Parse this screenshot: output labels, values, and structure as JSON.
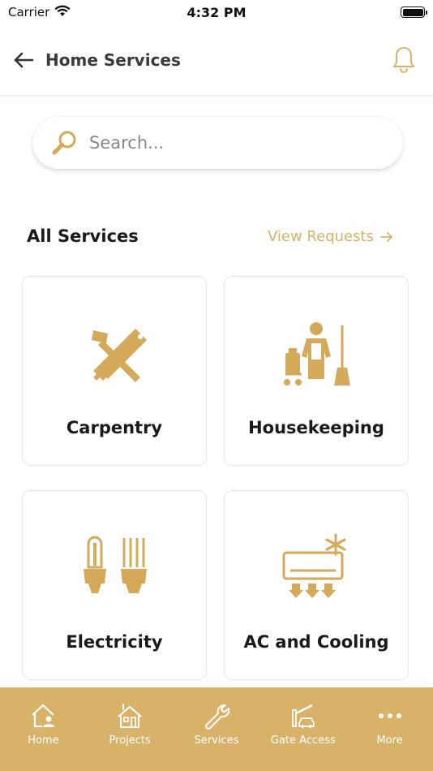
{
  "status": {
    "carrier": "Carrier",
    "time": "4:32 PM"
  },
  "header": {
    "title": "Home Services"
  },
  "search": {
    "placeholder": "Search..."
  },
  "section": {
    "title": "All Services",
    "view_requests": "View Requests"
  },
  "services": [
    {
      "label": "Carpentry",
      "icon": "carpentry-icon"
    },
    {
      "label": "Housekeeping",
      "icon": "housekeeping-icon"
    },
    {
      "label": "Electricity",
      "icon": "electricity-icon"
    },
    {
      "label": "AC and Cooling",
      "icon": "ac-cooling-icon"
    }
  ],
  "tabs": [
    {
      "label": "Home",
      "icon": "home-icon"
    },
    {
      "label": "Projects",
      "icon": "projects-icon"
    },
    {
      "label": "Services",
      "icon": "wrench-icon"
    },
    {
      "label": "Gate Access",
      "icon": "gate-access-icon"
    },
    {
      "label": "More",
      "icon": "more-icon"
    }
  ],
  "colors": {
    "accent": "#d9b26a",
    "icon_gold": "#d4aa5a",
    "text": "#1a1a1a"
  }
}
